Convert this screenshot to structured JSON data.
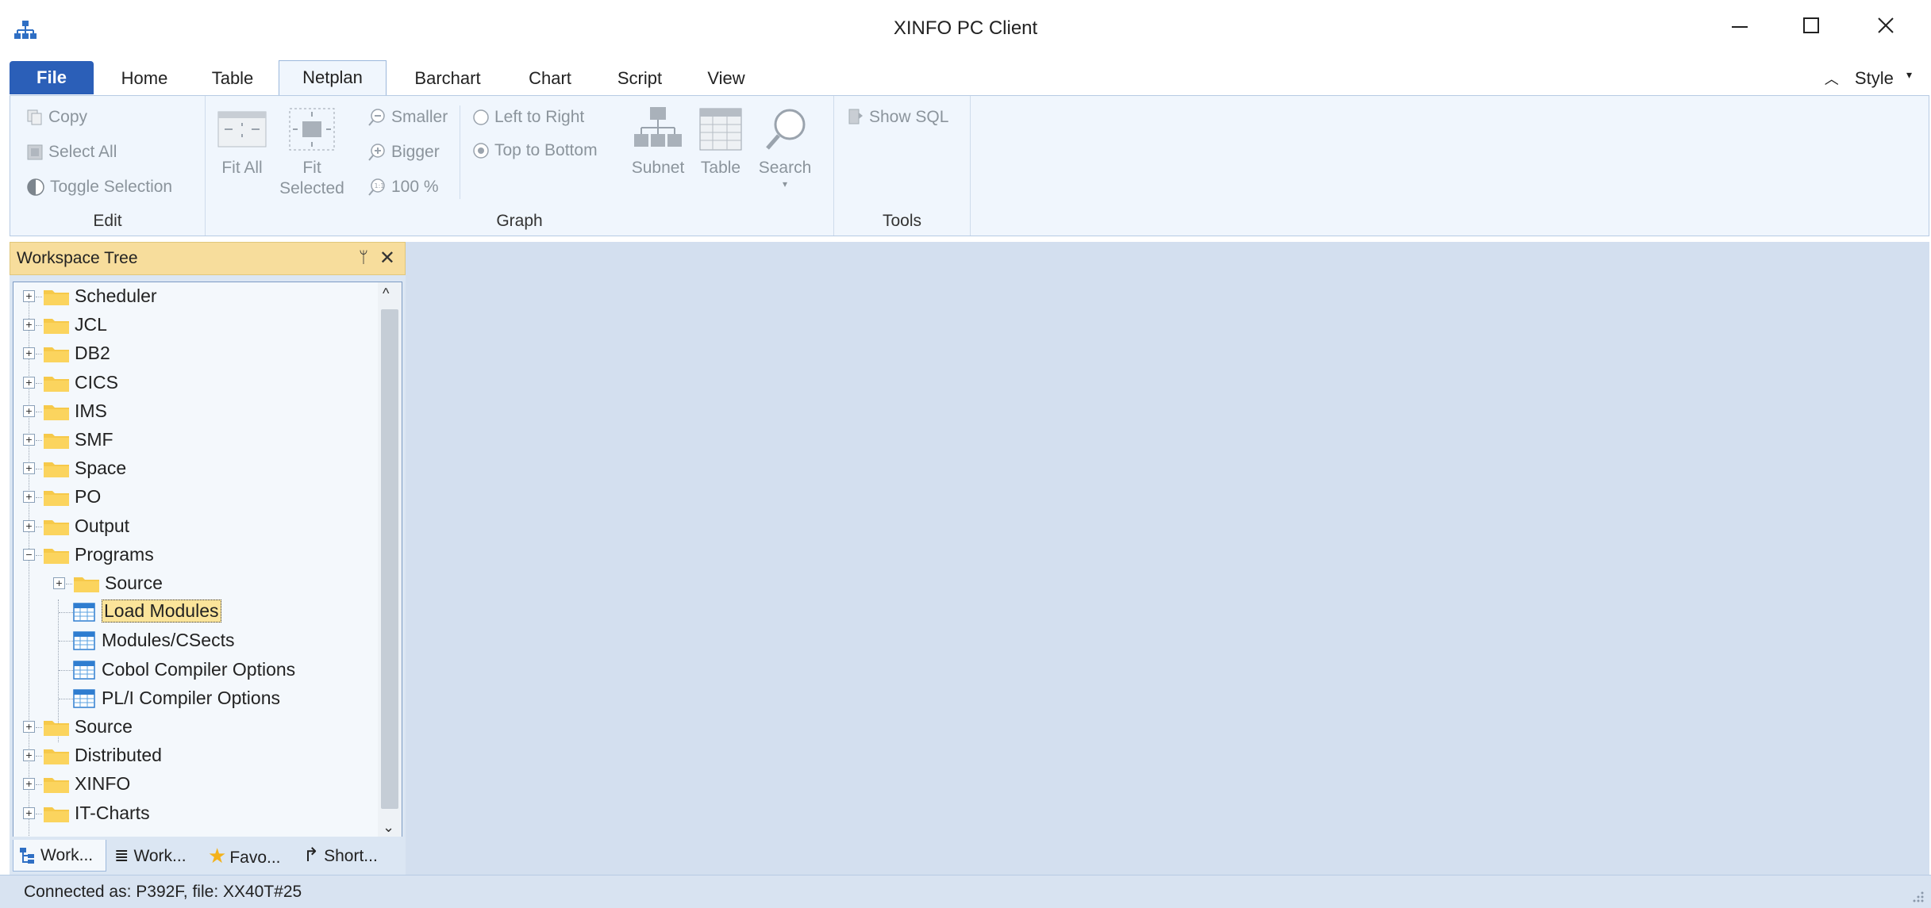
{
  "window": {
    "title": "XINFO PC Client",
    "minimize_glyph": "—",
    "maximize_glyph": "☐",
    "close_glyph": "✕"
  },
  "ribbon_tabs": [
    {
      "label": "File"
    },
    {
      "label": "Home"
    },
    {
      "label": "Table"
    },
    {
      "label": "Netplan"
    },
    {
      "label": "Barchart"
    },
    {
      "label": "Chart"
    },
    {
      "label": "Script"
    },
    {
      "label": "View"
    }
  ],
  "active_tab": "Netplan",
  "style_button": {
    "label": "Style"
  },
  "ribbon": {
    "edit": {
      "label": "Edit",
      "copy": "Copy",
      "select_all": "Select All",
      "toggle_selection": "Toggle Selection"
    },
    "graph": {
      "label": "Graph",
      "fit_all": "Fit All",
      "fit_selected": "Fit Selected",
      "smaller": "Smaller",
      "bigger": "Bigger",
      "zoom_100": "100 %",
      "left_to_right": "Left to Right",
      "top_to_bottom": "Top to Bottom",
      "subnet": "Subnet",
      "table": "Table",
      "search": "Search"
    },
    "tools": {
      "label": "Tools",
      "show_sql": "Show SQL"
    }
  },
  "workspace_panel": {
    "title": "Workspace Tree",
    "pin_glyph": "ᛘ",
    "close_glyph": "✕"
  },
  "tree": {
    "items": [
      {
        "label": "Scheduler",
        "type": "folder",
        "level": 0,
        "expander": "+"
      },
      {
        "label": "JCL",
        "type": "folder",
        "level": 0,
        "expander": "+"
      },
      {
        "label": "DB2",
        "type": "folder",
        "level": 0,
        "expander": "+"
      },
      {
        "label": "CICS",
        "type": "folder",
        "level": 0,
        "expander": "+"
      },
      {
        "label": "IMS",
        "type": "folder",
        "level": 0,
        "expander": "+"
      },
      {
        "label": "SMF",
        "type": "folder",
        "level": 0,
        "expander": "+"
      },
      {
        "label": "Space",
        "type": "folder",
        "level": 0,
        "expander": "+"
      },
      {
        "label": "PO",
        "type": "folder",
        "level": 0,
        "expander": "+"
      },
      {
        "label": "Output",
        "type": "folder",
        "level": 0,
        "expander": "+"
      },
      {
        "label": "Programs",
        "type": "folder",
        "level": 0,
        "expander": "−"
      },
      {
        "label": "Source",
        "type": "folder",
        "level": 1,
        "expander": "+"
      },
      {
        "label": "Load Modules",
        "type": "table",
        "level": 1,
        "selected": true
      },
      {
        "label": "Modules/CSects",
        "type": "table",
        "level": 1
      },
      {
        "label": "Cobol Compiler Options",
        "type": "table",
        "level": 1
      },
      {
        "label": "PL/I Compiler Options",
        "type": "table",
        "level": 1
      },
      {
        "label": "Source",
        "type": "folder",
        "level": 0,
        "expander": "+"
      },
      {
        "label": "Distributed",
        "type": "folder",
        "level": 0,
        "expander": "+"
      },
      {
        "label": "XINFO",
        "type": "folder",
        "level": 0,
        "expander": "+"
      },
      {
        "label": "IT-Charts",
        "type": "folder",
        "level": 0,
        "expander": "+"
      }
    ]
  },
  "bottom_tabs": [
    {
      "label": "Work..."
    },
    {
      "label": "Work..."
    },
    {
      "label": "Favo..."
    },
    {
      "label": "Short..."
    }
  ],
  "status": {
    "text": "Connected as: P392F, file: XX40T#25"
  },
  "colors": {
    "file_tab": "#2b5fb8",
    "ribbon_bg": "#f0f6fd",
    "panel_header": "#f7dd9c",
    "main_area": "#d3dfef",
    "selection": "#fbe49a",
    "folder": "#f6c94a"
  }
}
